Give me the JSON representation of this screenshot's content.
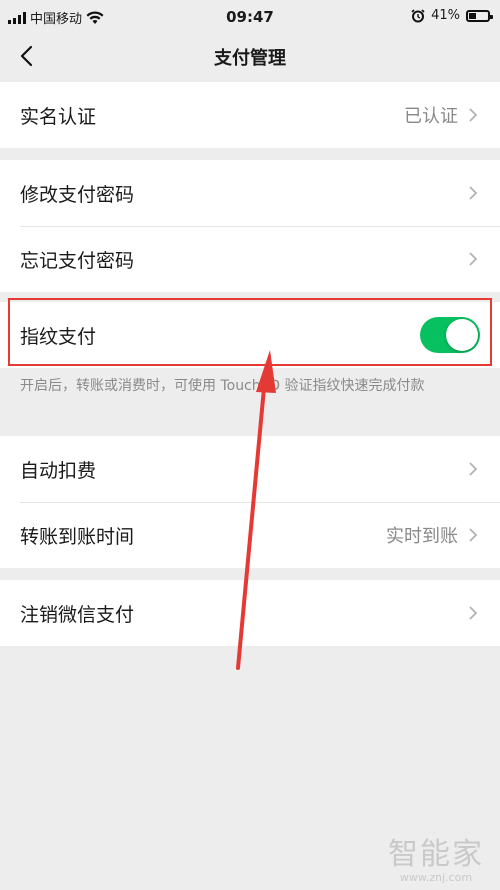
{
  "status_bar": {
    "carrier": "中国移动",
    "time": "09:47",
    "battery": "41%"
  },
  "nav": {
    "title": "支付管理"
  },
  "section1": {
    "verify_label": "实名认证",
    "verify_value": "已认证"
  },
  "section2": {
    "change_password_label": "修改支付密码",
    "forgot_password_label": "忘记支付密码"
  },
  "section3": {
    "fingerprint_label": "指纹支付",
    "fingerprint_enabled": true,
    "hint": "开启后，转账或消费时，可使用 Touch ID 验证指纹快速完成付款"
  },
  "section4": {
    "auto_deduct_label": "自动扣费",
    "transfer_time_label": "转账到账时间",
    "transfer_time_value": "实时到账"
  },
  "section5": {
    "cancel_pay_label": "注销微信支付"
  },
  "watermark": {
    "main": "智能家",
    "sub": "www.znj.com"
  },
  "colors": {
    "background": "#ededed",
    "toggle_on": "#07c160",
    "annotation": "#e53935"
  }
}
